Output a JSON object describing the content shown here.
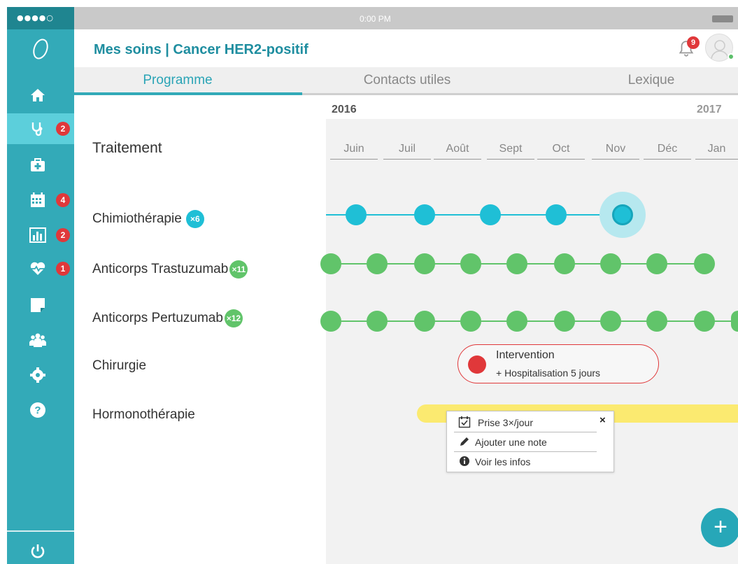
{
  "status_bar": {
    "signal": "●●●●○",
    "time": "0:00 PM"
  },
  "header": {
    "title": "Mes soins | Cancer HER2-positif",
    "notifications_count": "9"
  },
  "tabs": [
    {
      "label": "Programme",
      "active": true
    },
    {
      "label": "Contacts utiles",
      "active": false
    },
    {
      "label": "Lexique",
      "active": false
    }
  ],
  "sidebar": {
    "items": [
      {
        "icon": "home-icon",
        "badge": ""
      },
      {
        "icon": "stethoscope-icon",
        "badge": "2",
        "active": true
      },
      {
        "icon": "medical-kit-icon",
        "badge": ""
      },
      {
        "icon": "calendar-icon",
        "badge": "4"
      },
      {
        "icon": "bar-chart-icon",
        "badge": "2"
      },
      {
        "icon": "heartbeat-icon",
        "badge": "1"
      },
      {
        "icon": "note-icon",
        "badge": ""
      },
      {
        "icon": "group-icon",
        "badge": ""
      },
      {
        "icon": "gear-icon",
        "badge": ""
      },
      {
        "icon": "help-icon",
        "badge": ""
      },
      {
        "icon": "power-icon",
        "badge": ""
      }
    ]
  },
  "timeline": {
    "year_start": "2016",
    "year_end": "2017",
    "section_label": "Traitement",
    "months": [
      "Juin",
      "Juil",
      "Août",
      "Sept",
      "Oct",
      "Nov",
      "Déc",
      "Jan"
    ],
    "rows": [
      {
        "label": "Chimiothérapie",
        "count": "×6",
        "color": "#1fbfd6"
      },
      {
        "label": "Anticorps Trastuzumab",
        "count": "×11",
        "color": "#61c46a"
      },
      {
        "label": "Anticorps Pertuzumab",
        "count": "×12",
        "color": "#61c46a"
      },
      {
        "label": "Chirurgie",
        "count": "",
        "color": "#e0383a"
      },
      {
        "label": "Hormonothérapie",
        "count": "",
        "color": "#fbea70"
      }
    ],
    "intervention": {
      "title": "Intervention",
      "subtitle": "+ Hospitalisation 5 jours"
    },
    "popup": {
      "items": [
        {
          "icon": "calendar-check-icon",
          "label": "Prise 3×/jour"
        },
        {
          "icon": "pencil-icon",
          "label": "Ajouter une note"
        },
        {
          "icon": "info-icon",
          "label": "Voir les infos"
        }
      ],
      "close": "×"
    }
  },
  "fab": {
    "label": "+"
  },
  "colors": {
    "accent": "#33aab8",
    "title": "#1f8ea0",
    "badge": "#e0383a"
  }
}
